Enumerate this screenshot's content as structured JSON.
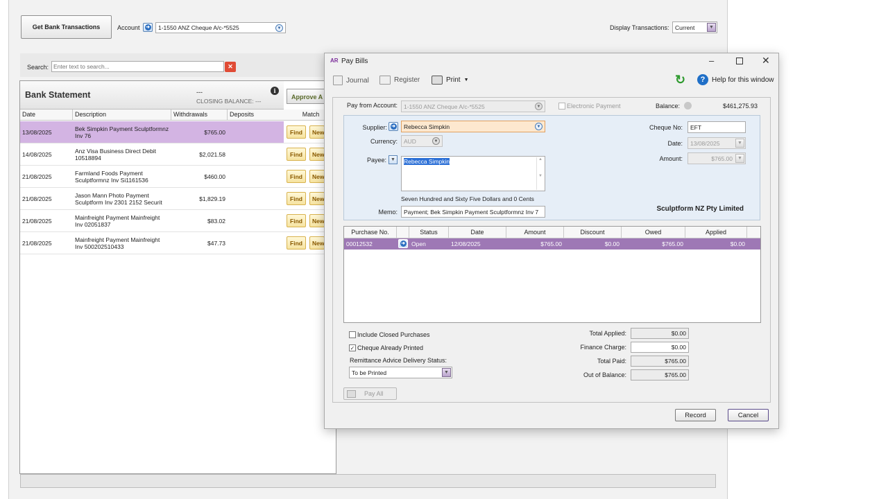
{
  "bank_feed": {
    "get_button": "Get Bank Transactions",
    "account_label": "Account",
    "account_value": "1-1550 ANZ Cheque A/c-*5525",
    "display_label": "Display Transactions:",
    "display_value": "Current",
    "search_label": "Search:",
    "search_placeholder": "Enter text to search...",
    "statement_title": "Bank Statement",
    "closing_dash": "---",
    "closing_label": "CLOSING BALANCE: ---",
    "approve_label": "Approve A",
    "columns": [
      "Date",
      "Description",
      "Withdrawals",
      "Deposits",
      "Match"
    ],
    "find_label": "Find",
    "new_label": "New",
    "rows": [
      {
        "date": "13/08/2025",
        "desc": "Bek Simpkin Payment Sculptformnz\nInv 76",
        "withdrawal": "$765.00"
      },
      {
        "date": "14/08/2025",
        "desc": "Anz Visa Business Direct Debit\n10518894",
        "withdrawal": "$2,021.58"
      },
      {
        "date": "21/08/2025",
        "desc": "Farmland Foods Payment\nSculptformnz Inv Si1161536",
        "withdrawal": "$460.00"
      },
      {
        "date": "21/08/2025",
        "desc": "Jason Mann Photo Payment\nSculptform Inv 2301 2152 Securit",
        "withdrawal": "$1,829.19"
      },
      {
        "date": "21/08/2025",
        "desc": "Mainfreight Payment Mainfreight\nInv 02051837",
        "withdrawal": "$83.02"
      },
      {
        "date": "21/08/2025",
        "desc": "Mainfreight Payment Mainfreight\nInv 500202510433",
        "withdrawal": "$47.73"
      }
    ]
  },
  "dialog": {
    "badge": "AR",
    "title": "Pay Bills",
    "toolbar": {
      "journal": "Journal",
      "register": "Register",
      "print": "Print",
      "help": "Help for this window"
    },
    "pay_from_label": "Pay from Account:",
    "pay_from_value": "1-1550 ANZ Cheque A/c-*5525",
    "electronic_label": "Electronic Payment",
    "balance_label": "Balance:",
    "balance_value": "$461,275.93",
    "supplier_label": "Supplier:",
    "supplier_value": "Rebecca Simpkin",
    "currency_label": "Currency:",
    "currency_value": "AUD",
    "payee_label": "Payee:",
    "payee_value": "Rebecca Simpkin",
    "amount_words": "Seven Hundred and Sixty Five Dollars and 0 Cents",
    "memo_label": "Memo:",
    "memo_value": "Payment; Bek Simpkin Payment Sculptformnz  Inv 7",
    "cheque_label": "Cheque No:",
    "cheque_value": "EFT",
    "date_label": "Date:",
    "date_value": "13/08/2025",
    "amount_label": "Amount:",
    "amount_value": "$765.00",
    "company": "Sculptform NZ Pty Limited",
    "grid_columns": [
      "Purchase No.",
      "Status",
      "Date",
      "Amount",
      "Discount",
      "Owed",
      "Applied"
    ],
    "grid_row": {
      "purchase_no": "00012532",
      "status": "Open",
      "date": "12/08/2025",
      "amount": "$765.00",
      "discount": "$0.00",
      "owed": "$765.00",
      "applied": "$0.00"
    },
    "include_closed": "Include Closed Purchases",
    "cheque_printed": "Cheque Already Printed",
    "remittance_label": "Remittance Advice Delivery Status:",
    "remittance_value": "To be Printed",
    "pay_all": "Pay All",
    "totals": {
      "applied_label": "Total Applied:",
      "applied": "$0.00",
      "finance_label": "Finance Charge:",
      "finance": "$0.00",
      "paid_label": "Total Paid:",
      "paid": "$765.00",
      "oob_label": "Out of Balance:",
      "oob": "$765.00"
    },
    "record": "Record",
    "cancel": "Cancel"
  },
  "colors": {
    "selected_row": "#d3b4e3",
    "grid_row": "#9e78b5",
    "supplier_highlight": "#fde8cf"
  }
}
